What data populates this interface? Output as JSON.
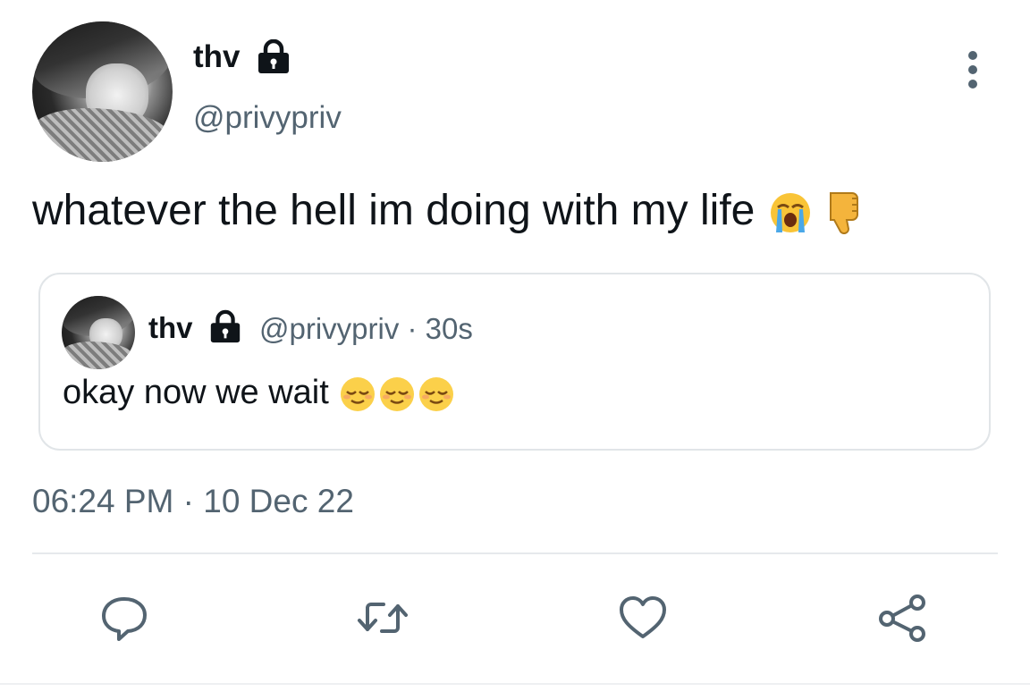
{
  "tweet": {
    "author_name": "thv",
    "author_handle": "@privypriv",
    "text": "whatever the hell im doing with my life",
    "text_emojis": [
      "loudly-crying-face",
      "thumbs-down"
    ],
    "timestamp": "06:24 PM · 10 Dec 22"
  },
  "quote": {
    "author_name": "thv",
    "author_handle_time": "@privypriv · 30s",
    "text": "okay now we wait",
    "text_emojis": [
      "relieved-face",
      "relieved-face",
      "relieved-face"
    ]
  },
  "actions": {
    "icons": [
      "reply-icon",
      "retweet-icon",
      "like-icon",
      "share-icon"
    ]
  },
  "colors": {
    "primary_text": "#0f1419",
    "secondary_text": "#536471",
    "border": "#e1e5e8"
  }
}
